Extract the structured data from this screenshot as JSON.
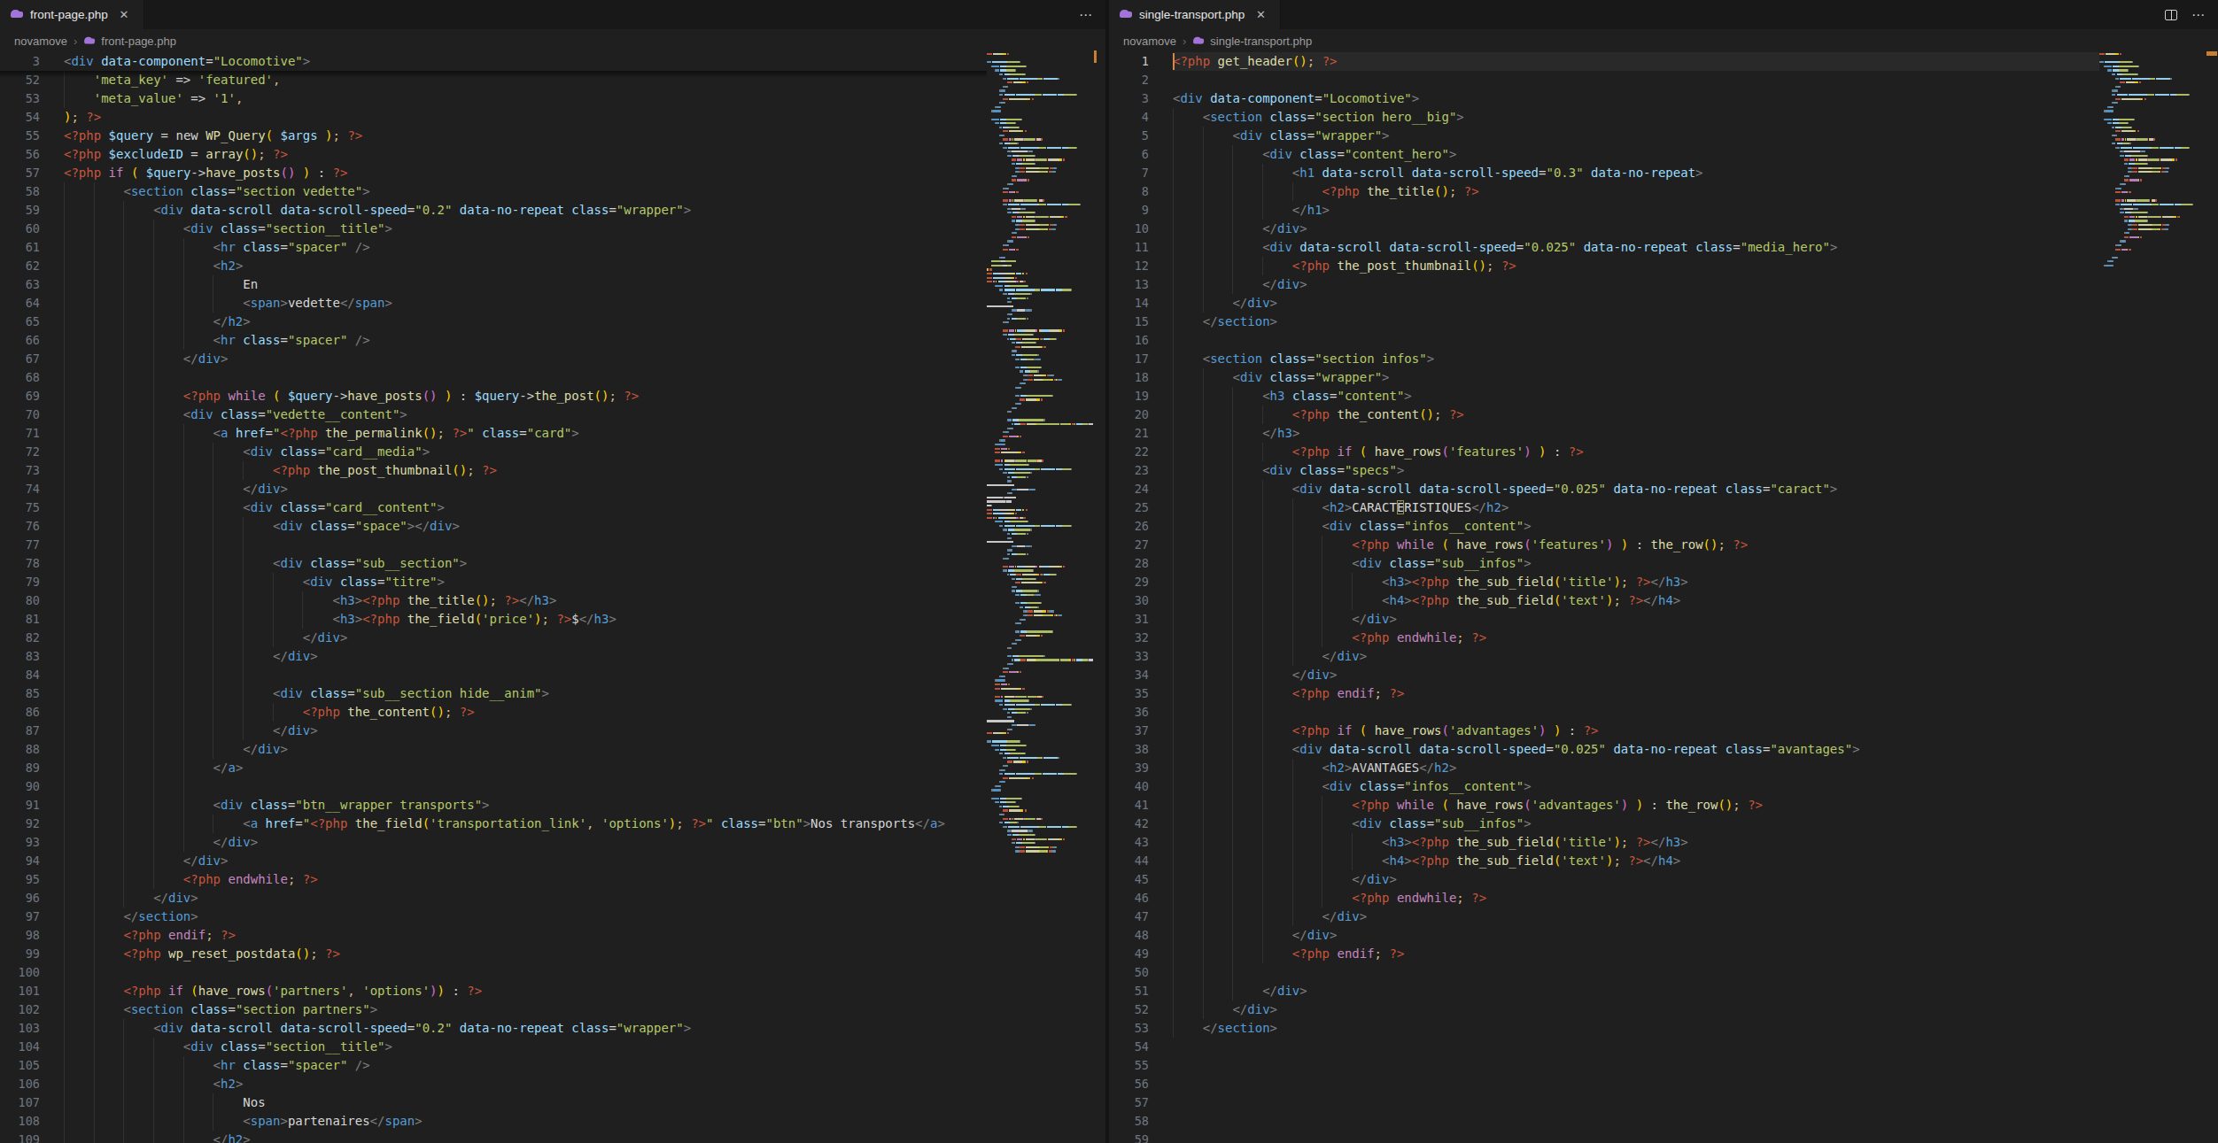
{
  "theme": {
    "editor_bg": "#1f1f1f",
    "tabbar_bg": "#181818",
    "accent_orange": "#c87f2f",
    "string": "#b5c969",
    "tag": "#569cd6",
    "attr": "#9cdcfe",
    "php_tag": "#c8563c",
    "keyword": "#c586c0",
    "function": "#dcdcaa",
    "bracket1": "#ffd700",
    "bracket2": "#da70d6"
  },
  "left_editor": {
    "tab_label": "front-page.php",
    "close_label": "✕",
    "breadcrumb": [
      "novamove",
      "front-page.php"
    ],
    "actions_dots": "⋯",
    "sticky_line": {
      "number": "3",
      "text": "<div data-component=\"Locomotive\">"
    },
    "first_line_number": 52,
    "php_continuation_lines": [
      52,
      53,
      54
    ],
    "lines": [
      "    'meta_key' => 'featured',",
      "    'meta_value' => '1',",
      "); ?>",
      "<?php $query = new WP_Query( $args ); ?>",
      "<?php $excludeID = array(); ?>",
      "<?php if ( $query->have_posts() ) : ?>",
      "        <section class=\"section vedette\">",
      "            <div data-scroll data-scroll-speed=\"0.2\" data-no-repeat class=\"wrapper\">",
      "                <div class=\"section__title\">",
      "                    <hr class=\"spacer\" />",
      "                    <h2>",
      "                        En",
      "                        <span>vedette</span>",
      "                    </h2>",
      "                    <hr class=\"spacer\" />",
      "                </div>",
      "",
      "                <?php while ( $query->have_posts() ) : $query->the_post(); ?>",
      "                <div class=\"vedette__content\">",
      "                    <a href=\"<?php the_permalink(); ?>\" class=\"card\">",
      "                        <div class=\"card__media\">",
      "                            <?php the_post_thumbnail(); ?>",
      "                        </div>",
      "                        <div class=\"card__content\">",
      "                            <div class=\"space\"></div>",
      "",
      "                            <div class=\"sub__section\">",
      "                                <div class=\"titre\">",
      "                                    <h3><?php the_title(); ?></h3>",
      "                                    <h3><?php the_field('price'); ?>$</h3>",
      "                                </div>",
      "                            </div>",
      "",
      "                            <div class=\"sub__section hide__anim\">",
      "                                <?php the_content(); ?>",
      "                            </div>",
      "                        </div>",
      "                    </a>",
      "",
      "                    <div class=\"btn__wrapper transports\">",
      "                        <a href=\"<?php the_field('transportation_link', 'options'); ?>\" class=\"btn\">Nos transports</a>",
      "                    </div>",
      "                </div>",
      "                <?php endwhile; ?>",
      "            </div>",
      "        </section>",
      "        <?php endif; ?>",
      "        <?php wp_reset_postdata(); ?>",
      "",
      "        <?php if (have_rows('partners', 'options')) : ?>",
      "        <section class=\"section partners\">",
      "            <div data-scroll data-scroll-speed=\"0.2\" data-no-repeat class=\"wrapper\">",
      "                <div class=\"section__title\">",
      "                    <hr class=\"spacer\" />",
      "                    <h2>",
      "                        Nos",
      "                        <span>partenaires</span>",
      "                    </h2>"
    ]
  },
  "right_editor": {
    "tab_label": "single-transport.php",
    "close_label": "✕",
    "breadcrumb": [
      "novamove",
      "single-transport.php"
    ],
    "actions_dots": "⋯",
    "first_line_number": 1,
    "active_line": 1,
    "cursor": {
      "line": 1,
      "col": 0
    },
    "lines": [
      "<?php get_header(); ?>",
      "",
      "<div data-component=\"Locomotive\">",
      "    <section class=\"section hero__big\">",
      "        <div class=\"wrapper\">",
      "            <div class=\"content_hero\">",
      "                <h1 data-scroll data-scroll-speed=\"0.3\" data-no-repeat>",
      "                    <?php the_title(); ?>",
      "                </h1>",
      "            </div>",
      "            <div data-scroll data-scroll-speed=\"0.025\" data-no-repeat class=\"media_hero\">",
      "                <?php the_post_thumbnail(); ?>",
      "            </div>",
      "        </div>",
      "    </section>",
      "",
      "    <section class=\"section infos\">",
      "        <div class=\"wrapper\">",
      "            <h3 class=\"content\">",
      "                <?php the_content(); ?>",
      "            </h3>",
      "                <?php if ( have_rows('features') ) : ?>",
      "            <div class=\"specs\">",
      "                <div data-scroll data-scroll-speed=\"0.025\" data-no-repeat class=\"caract\">",
      "                    <h2>CARACTÉRISTIQUES</h2>",
      "                    <div class=\"infos__content\">",
      "                        <?php while ( have_rows('features') ) : the_row(); ?>",
      "                        <div class=\"sub__infos\">",
      "                            <h3><?php the_sub_field('title'); ?></h3>",
      "                            <h4><?php the_sub_field('text'); ?></h4>",
      "                        </div>",
      "                        <?php endwhile; ?>",
      "                    </div>",
      "                </div>",
      "                <?php endif; ?>",
      "",
      "                <?php if ( have_rows('advantages') ) : ?>",
      "                <div data-scroll data-scroll-speed=\"0.025\" data-no-repeat class=\"avantages\">",
      "                    <h2>AVANTAGES</h2>",
      "                    <div class=\"infos__content\">",
      "                        <?php while ( have_rows('advantages') ) : the_row(); ?>",
      "                        <div class=\"sub__infos\">",
      "                            <h3><?php the_sub_field('title'); ?></h3>",
      "                            <h4><?php the_sub_field('text'); ?></h4>",
      "                        </div>",
      "                        <?php endwhile; ?>",
      "                    </div>",
      "                </div>",
      "                <?php endif; ?>",
      "",
      "            </div>",
      "        </div>",
      "    </section>",
      "",
      "",
      "",
      "",
      "",
      ""
    ]
  }
}
